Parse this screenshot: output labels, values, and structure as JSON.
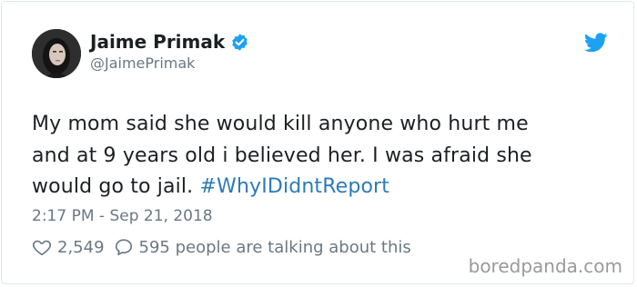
{
  "author": {
    "name": "Jaime Primak",
    "handle": "@JaimePrimak",
    "verified": true
  },
  "tweet": {
    "text_lines": [
      "My mom said she would kill anyone who hurt me",
      "and at 9 years old i believed her. I was afraid she",
      "would go to jail. "
    ],
    "hashtag": "#WhyIDidntReport",
    "timestamp": "2:17 PM - Sep 21, 2018"
  },
  "engagement": {
    "likes": "2,549",
    "replies_text": "595 people are talking about this"
  },
  "watermark": "boredpanda.com",
  "colors": {
    "verified_badge": "#1da1f2",
    "twitter_bird": "#1da1f2",
    "hashtag": "#2b7bb9",
    "meta_text": "#697882"
  },
  "icons": [
    "verified-icon",
    "twitter-bird-icon",
    "heart-icon",
    "reply-bubble-icon"
  ]
}
